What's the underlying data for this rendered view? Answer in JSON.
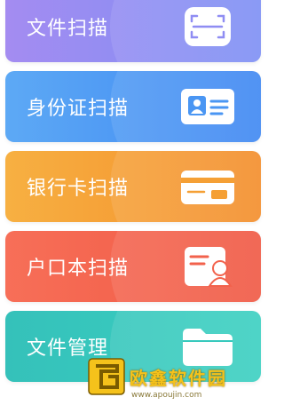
{
  "cards": [
    {
      "label": "文件扫描",
      "icon": "scan-frame-icon"
    },
    {
      "label": "身份证扫描",
      "icon": "id-card-icon"
    },
    {
      "label": "银行卡扫描",
      "icon": "bank-card-icon"
    },
    {
      "label": "户口本扫描",
      "icon": "household-register-icon"
    },
    {
      "label": "文件管理",
      "icon": "folder-icon"
    }
  ],
  "watermark": {
    "text": "欧鑫软件园",
    "url": "www.apoujin.com"
  },
  "colors": {
    "scan": "#8f8df3",
    "id": "#4a96f3",
    "bank": "#f5a035",
    "household": "#f2624c",
    "files": "#37c9bd"
  }
}
